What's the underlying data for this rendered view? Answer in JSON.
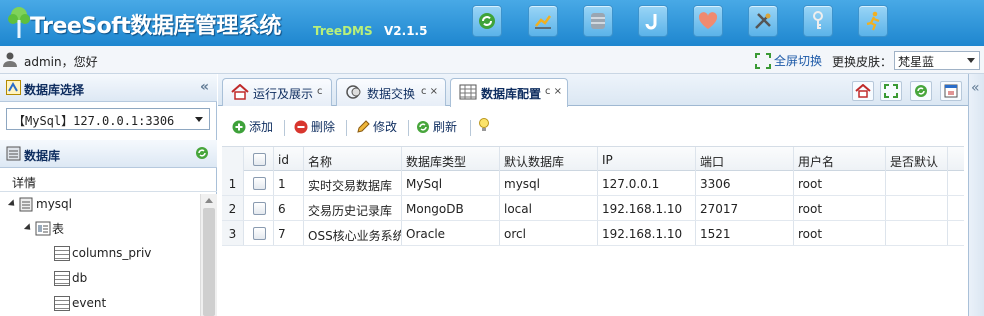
{
  "header": {
    "title": "TreeSoft数据库管理系统",
    "subtitle": "TreeDMS",
    "version": "V2.1.5"
  },
  "userbar": {
    "greeting": "admin，您好",
    "fullscreen_label": "全屏切换",
    "skin_label": "更换皮肤：",
    "skin_value": "梵星蓝"
  },
  "left": {
    "db_select_title": "数据库选择",
    "db_select_value": "【MySql】127.0.0.1:3306",
    "db_panel_title": "数据库",
    "detail_label": "详情",
    "tree": [
      "mysql",
      "表",
      "columns_priv",
      "db",
      "event"
    ]
  },
  "tabs": [
    {
      "label": "运行及展示",
      "close": "c"
    },
    {
      "label": "数据交换",
      "close": "c ×"
    },
    {
      "label": "数据库配置",
      "close": "c ×"
    }
  ],
  "toolbar": {
    "add": "添加",
    "delete": "删除",
    "edit": "修改",
    "refresh": "刷新"
  },
  "grid": {
    "columns": [
      "id",
      "名称",
      "数据库类型",
      "默认数据库",
      "IP",
      "端口",
      "用户名",
      "是否默认"
    ],
    "rows": [
      {
        "num": "1",
        "id": "1",
        "name": "实时交易数据库",
        "type": "MySql",
        "defdb": "mysql",
        "ip": "127.0.0.1",
        "port": "3306",
        "user": "root",
        "is_default": ""
      },
      {
        "num": "2",
        "id": "6",
        "name": "交易历史记录库",
        "type": "MongoDB",
        "defdb": "local",
        "ip": "192.168.1.10",
        "port": "27017",
        "user": "root",
        "is_default": ""
      },
      {
        "num": "3",
        "id": "7",
        "name": "OSS核心业务系统",
        "type": "Oracle",
        "defdb": "orcl",
        "ip": "192.168.1.10",
        "port": "1521",
        "user": "root",
        "is_default": ""
      }
    ]
  },
  "colors": {
    "header_top": "#48a9e6",
    "header_bottom": "#1e86cf",
    "link": "#1d5aa8",
    "panel_text": "#0e2d5f"
  }
}
